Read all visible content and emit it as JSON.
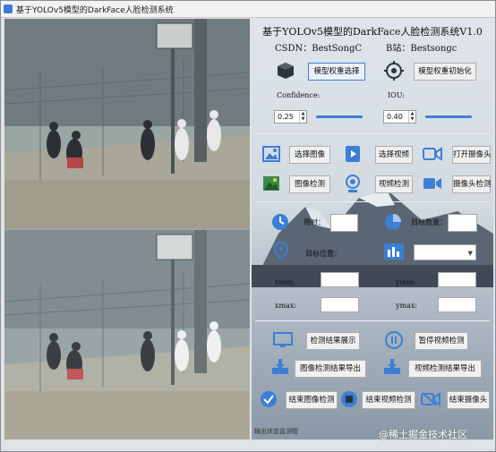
{
  "window": {
    "title": "基于YOLOv5模型的DarkFace人脸检测系统"
  },
  "header": {
    "title": "基于YOLOv5模型的DarkFace人脸检测系统V1.0",
    "csdn": "CSDN：BestSongC",
    "bili": "B站：Bestsongc"
  },
  "model": {
    "select_label": "模型权重选择",
    "init_label": "模型权重初始化"
  },
  "params": {
    "confidence_label": "Confidence:",
    "confidence_value": "0.25",
    "iou_label": "IOU:",
    "iou_value": "0.40",
    "confidence_level": 0.25,
    "iou_level": 0.4
  },
  "actions": {
    "select_image": "选择图像",
    "select_video": "选择视频",
    "open_camera": "打开摄像头",
    "image_detect": "图像检测",
    "video_detect": "视频检测",
    "camera_detect": "摄像头检测"
  },
  "info": {
    "time_label": "用时：",
    "target_count_label": "目标数量：",
    "target_pos_label": "目标位置：",
    "xmin_label": "xmin:",
    "ymin_label": "ymin:",
    "xmax_label": "xmax:",
    "ymax_label": "ymax:"
  },
  "results": {
    "show_results": "检测结果展示",
    "pause_video": "暂停视频检测",
    "export_image": "图像检测结果导出",
    "export_video": "视频检测结果导出",
    "end_image": "结束图像检测",
    "end_video": "结束视频检测",
    "end_camera": "结束摄像头"
  },
  "status": {
    "text": "输出状态监测框"
  },
  "watermark": {
    "text": "@稀土掘金技术社区"
  },
  "colors": {
    "accent": "#3c7fd6",
    "dark_icon": "#2a3540"
  },
  "icons": {
    "model_select": "cube-icon",
    "model_init": "target-icon",
    "select_image": "image-icon",
    "select_video": "video-file-icon",
    "open_camera": "camera-outline-icon",
    "image_detect": "landscape-icon",
    "video_detect": "webcam-icon",
    "camera_detect": "video-camera-icon",
    "time": "clock-icon",
    "count": "pie-chart-icon",
    "position": "location-pin-icon",
    "combo": "bar-chart-icon",
    "show_results": "monitor-icon",
    "pause": "pause-icon",
    "export_image": "download-icon",
    "export_video": "download-icon",
    "end_image": "check-circle-icon",
    "end_video": "stop-icon",
    "end_camera": "camera-off-icon"
  }
}
